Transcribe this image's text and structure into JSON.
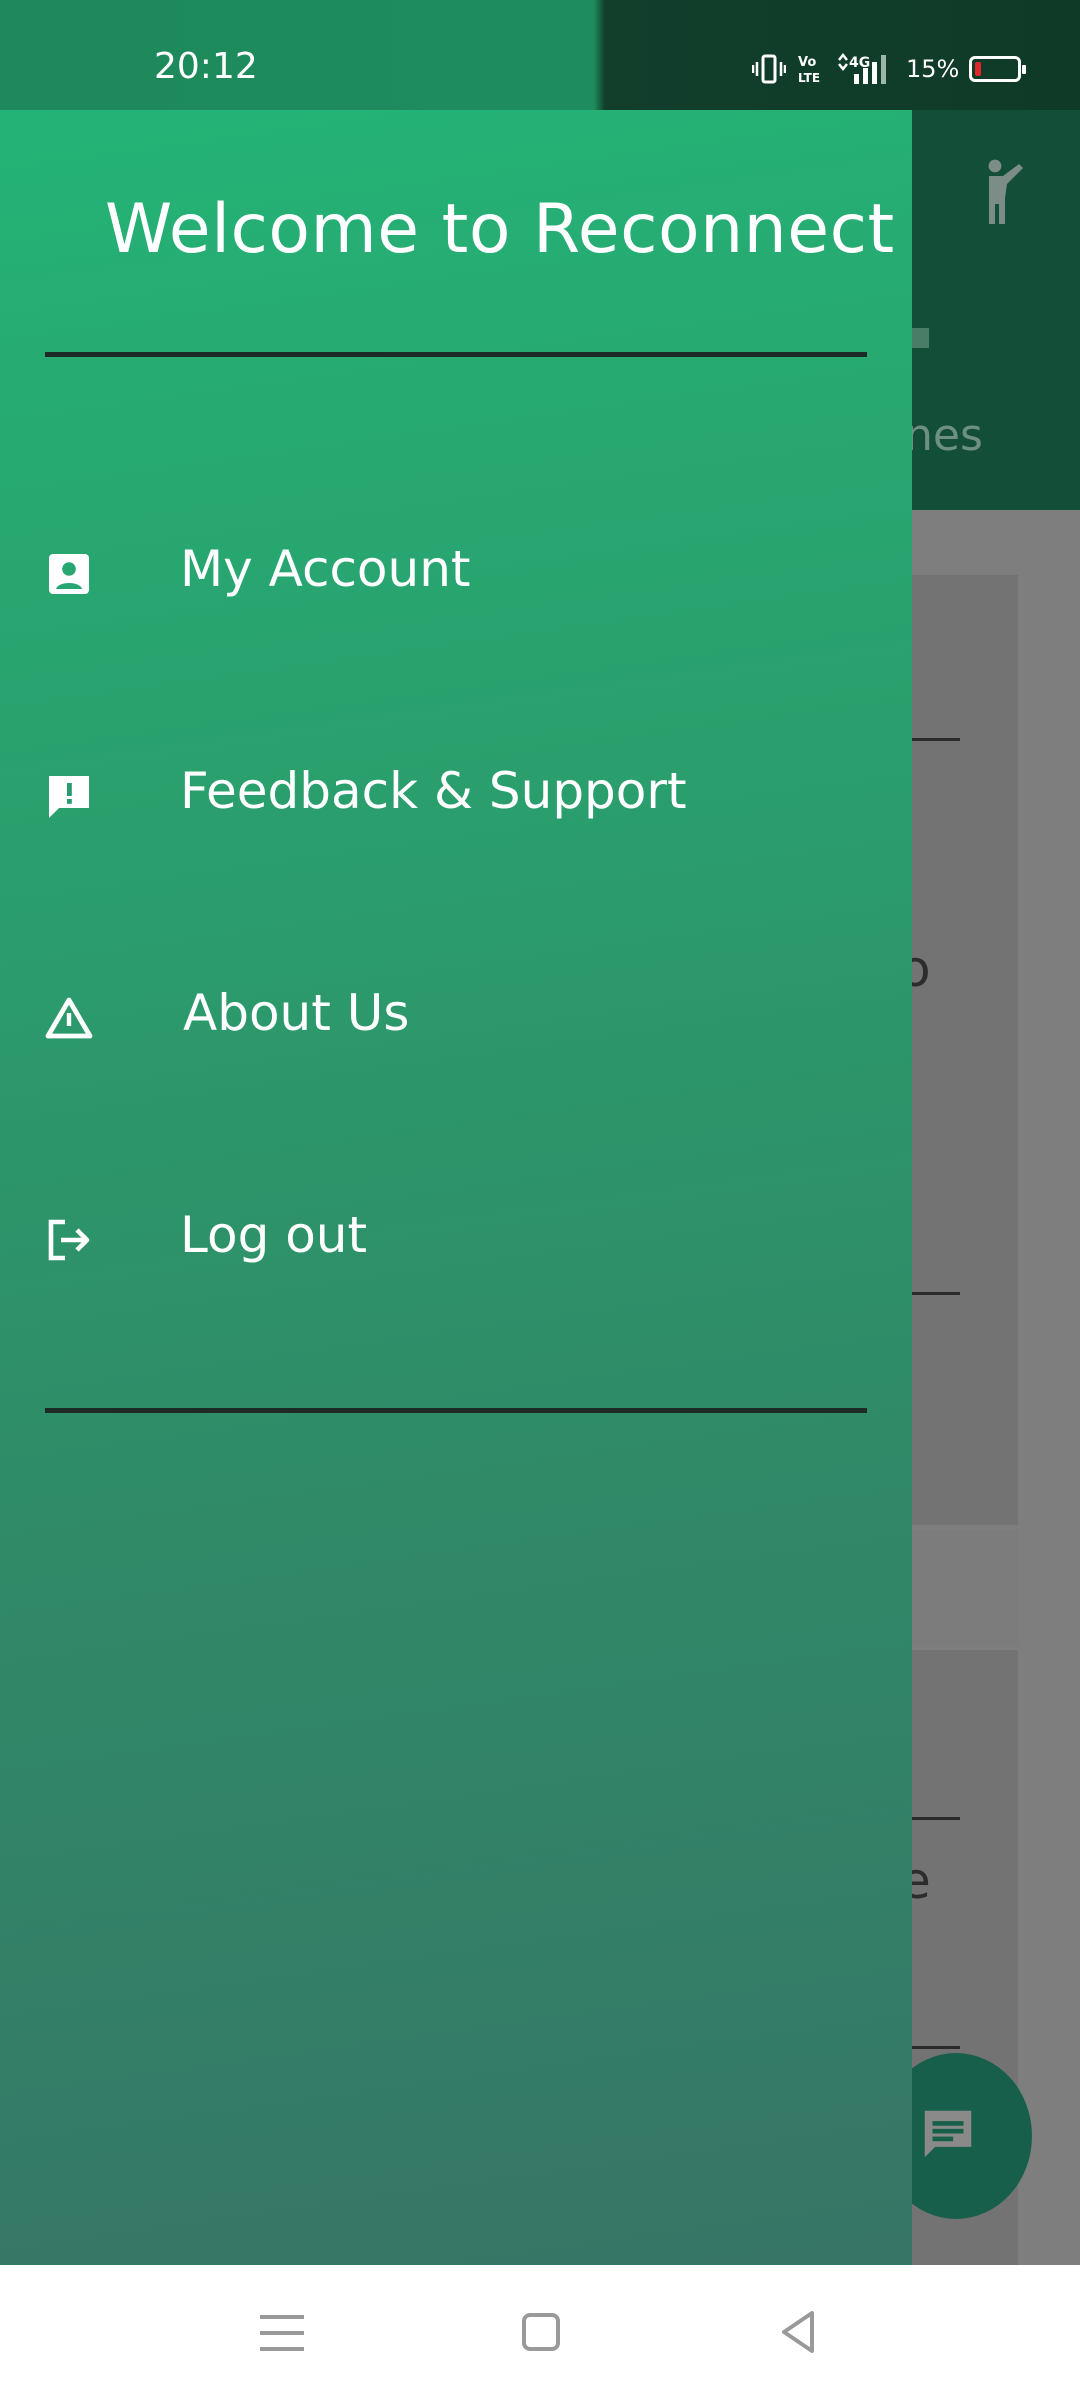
{
  "status_bar": {
    "time": "20:12",
    "battery_percent": "15%",
    "network": "4G",
    "volte": "VoLTE",
    "battery_level": 0.15,
    "battery_color": "#e0262b"
  },
  "drawer": {
    "title": "Welcome to Reconnect",
    "items": [
      {
        "label": "My Account",
        "icon": "account-box-icon"
      },
      {
        "label": "Feedback & Support",
        "icon": "feedback-icon"
      },
      {
        "label": "About Us",
        "icon": "warning-triangle-icon"
      },
      {
        "label": "Log out",
        "icon": "logout-icon"
      }
    ]
  },
  "background": {
    "tab_fragment": "nes",
    "text_fragments": [
      "o",
      "e"
    ]
  },
  "colors": {
    "drawer_top": "#24b376",
    "drawer_bottom": "#377566",
    "app_bar": "#134f38",
    "fab": "#175f4a"
  },
  "system_nav": {
    "buttons": [
      "menu-icon",
      "home-icon",
      "back-icon"
    ]
  }
}
